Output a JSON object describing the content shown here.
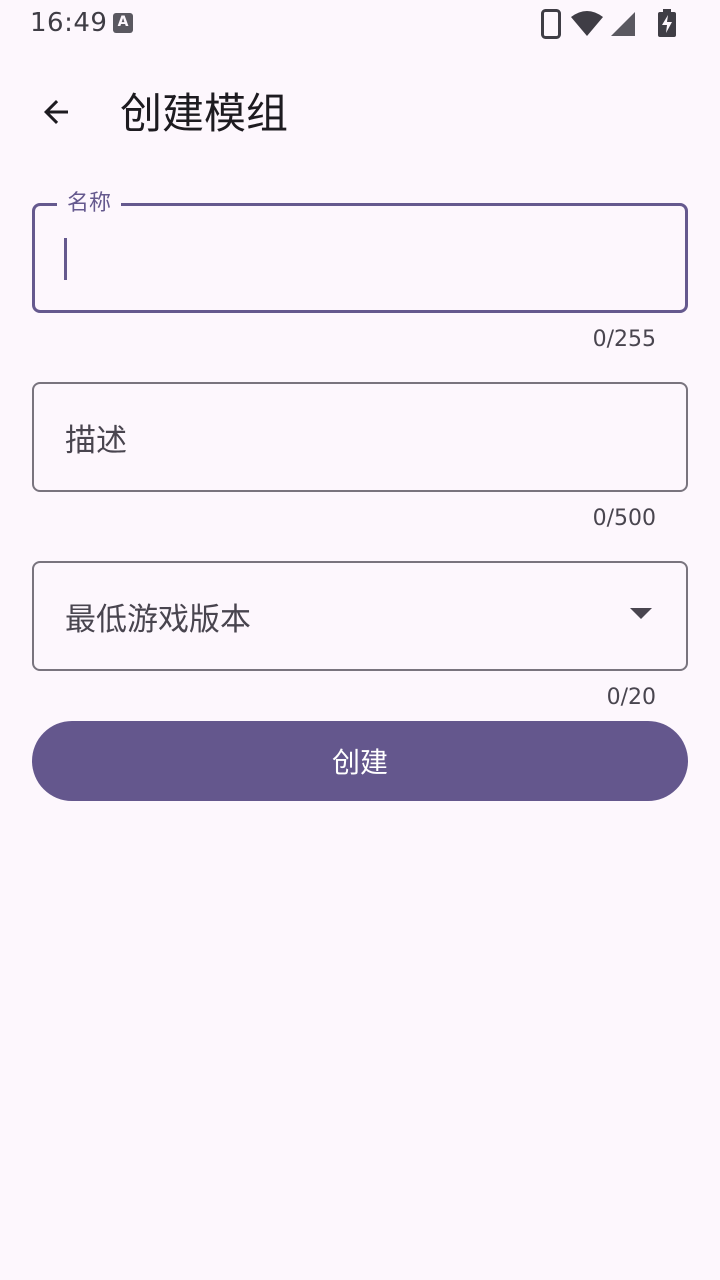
{
  "status_bar": {
    "time": "16:49",
    "notification_icon": "keyboard-a-icon",
    "icons": [
      "phone-icon",
      "wifi-icon",
      "cell-signal-icon",
      "battery-charging-icon"
    ]
  },
  "app_bar": {
    "back_icon": "arrow-back-icon",
    "title": "创建模组"
  },
  "form": {
    "name": {
      "label": "名称",
      "value": "",
      "counter": "0/255"
    },
    "description": {
      "label": "描述",
      "value": "",
      "counter": "0/500"
    },
    "min_game_version": {
      "label": "最低游戏版本",
      "value": "",
      "counter": "0/20",
      "icon": "dropdown-arrow-icon"
    }
  },
  "create_button": {
    "label": "创建"
  },
  "colors": {
    "background": "#FDF7FD",
    "primary": "#64578D",
    "outline": "#79747E",
    "on_surface": "#1D1B20"
  }
}
